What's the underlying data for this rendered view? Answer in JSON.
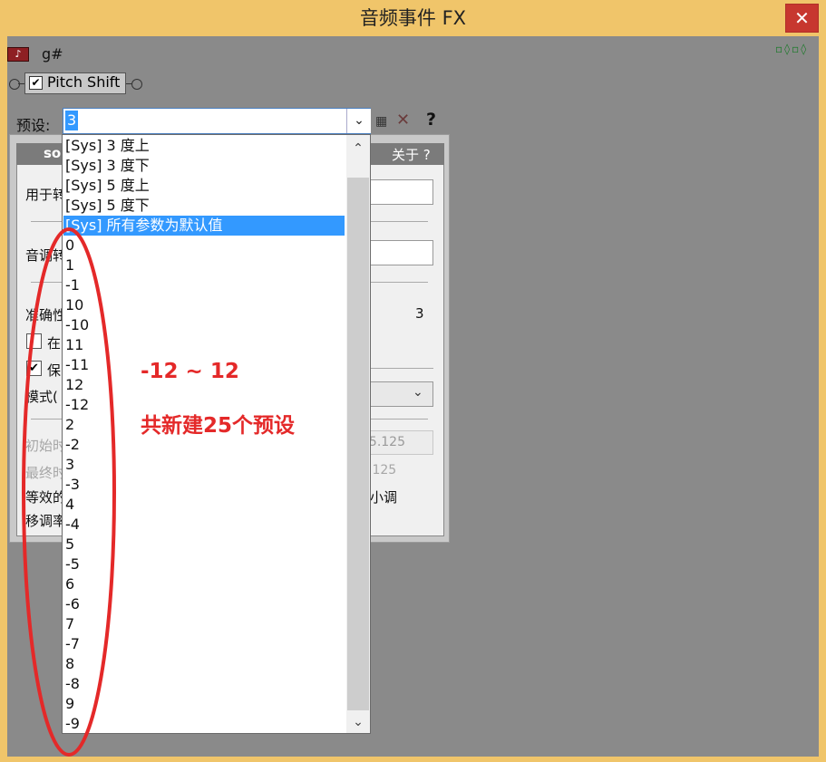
{
  "window": {
    "title": "音频事件 FX",
    "close": "✕"
  },
  "track": {
    "name": "g#",
    "icon_text": "♪"
  },
  "chain_icons": "▫◊▫◊",
  "plugin": {
    "name": "Pitch Shift",
    "checked": "✔"
  },
  "preset": {
    "label": "预设:",
    "value": "3",
    "dropdown_arrow": "chevron-down-icon",
    "options": [
      "[Sys] 3 度上",
      "[Sys] 3 度下",
      "[Sys] 5 度上",
      "[Sys] 5 度下",
      "[Sys] 所有参数为默认值",
      "0",
      "1",
      "-1",
      "10",
      "-10",
      "11",
      "-11",
      "12",
      "-12",
      "2",
      "-2",
      "3",
      "-3",
      "4",
      "-4",
      "5",
      "-5",
      "6",
      "-6",
      "7",
      "-7",
      "8",
      "-8",
      "9",
      "-9"
    ],
    "selected_option": "[Sys] 所有参数为默认值"
  },
  "panel": {
    "logo": "so",
    "about": "关于 ?",
    "label_use": "用于转",
    "label_pitch": "音调转",
    "label_accuracy": "准确性",
    "accuracy_value": "3",
    "check1_label": "在",
    "check2_label": "保",
    "mode_label": "模式(",
    "initial_label": "初始时",
    "initial_value": "5.125",
    "final_label": "最终时",
    "final_value": ".125",
    "equiv_label": "等效的",
    "equiv_suffix": "小调",
    "shift_label": "移调率"
  },
  "annotation": {
    "range": "-12 ~ 12",
    "summary": "共新建25个预设"
  },
  "colors": {
    "title_bar": "#f0c56a",
    "close": "#c7372f",
    "selection": "#3399ff",
    "annotation": "#e42929"
  }
}
